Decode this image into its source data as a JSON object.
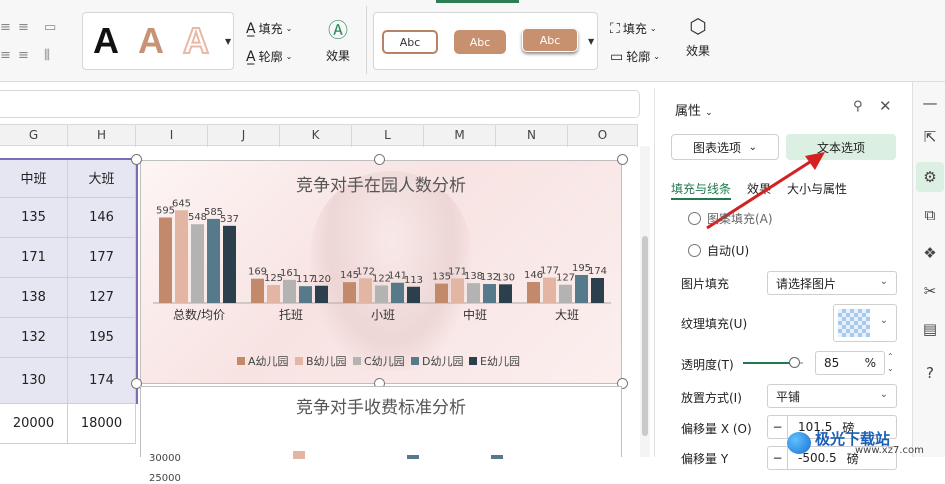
{
  "ribbon": {
    "fill_label": "填充",
    "outline_label": "轮廓",
    "effect_label": "效果",
    "shape_labels": [
      "Abc",
      "Abc",
      "Abc"
    ],
    "fill_label2": "填充",
    "outline_label2": "轮廓",
    "effect_label2": "效果"
  },
  "columns": [
    "G",
    "H",
    "I",
    "J",
    "K",
    "L",
    "M",
    "N",
    "O"
  ],
  "table": {
    "header": [
      "中班",
      "大班"
    ],
    "rows": [
      [
        "135",
        "146"
      ],
      [
        "171",
        "177"
      ],
      [
        "138",
        "127"
      ],
      [
        "132",
        "195"
      ],
      [
        "130",
        "174"
      ],
      [
        "20000",
        "18000"
      ]
    ]
  },
  "chart_data": [
    {
      "type": "bar",
      "title": "竞争对手在园人数分析",
      "categories": [
        "总数/均价",
        "托班",
        "小班",
        "中班",
        "大班"
      ],
      "series": [
        {
          "name": "A幼儿园",
          "color": "#c28a6b",
          "values": [
            595,
            169,
            145,
            135,
            146
          ]
        },
        {
          "name": "B幼儿园",
          "color": "#e2b6a2",
          "values": [
            645,
            125,
            172,
            171,
            177
          ]
        },
        {
          "name": "C幼儿园",
          "color": "#b3b3b3",
          "values": [
            548,
            161,
            122,
            138,
            127
          ]
        },
        {
          "name": "D幼儿园",
          "color": "#567a89",
          "values": [
            585,
            117,
            141,
            132,
            195
          ]
        },
        {
          "name": "E幼儿园",
          "color": "#2b3f4c",
          "values": [
            537,
            120,
            113,
            130,
            174
          ]
        }
      ],
      "ylim": [
        0,
        800
      ]
    },
    {
      "type": "bar",
      "title": "竞争对手收费标准分析",
      "yticks": [
        "30000",
        "25000"
      ]
    }
  ],
  "pane": {
    "title": "属性",
    "tab_chart": "图表选项",
    "tab_text": "文本选项",
    "subtab_fill": "填充与线条",
    "subtab_effect": "效果",
    "subtab_size": "大小与属性",
    "radio_pattern": "图案填充(A)",
    "radio_auto": "自动(U)",
    "picture_fill_label": "图片填充",
    "picture_fill_value": "请选择图片",
    "texture_fill_label": "纹理填充(U)",
    "transparency_label": "透明度(T)",
    "transparency_value": "85",
    "transparency_unit": "%",
    "transparency_level": 0.85,
    "placement_label": "放置方式(I)",
    "placement_value": "平铺",
    "offset_x_label": "偏移量 X (O)",
    "offset_x_value": "101.5",
    "offset_x_unit": "磅",
    "offset_y_label": "偏移量 Y",
    "offset_y_value": "-500.5",
    "offset_y_unit": "磅"
  },
  "watermark": {
    "brand": "极光下载站",
    "url": "www.xz7.com"
  }
}
